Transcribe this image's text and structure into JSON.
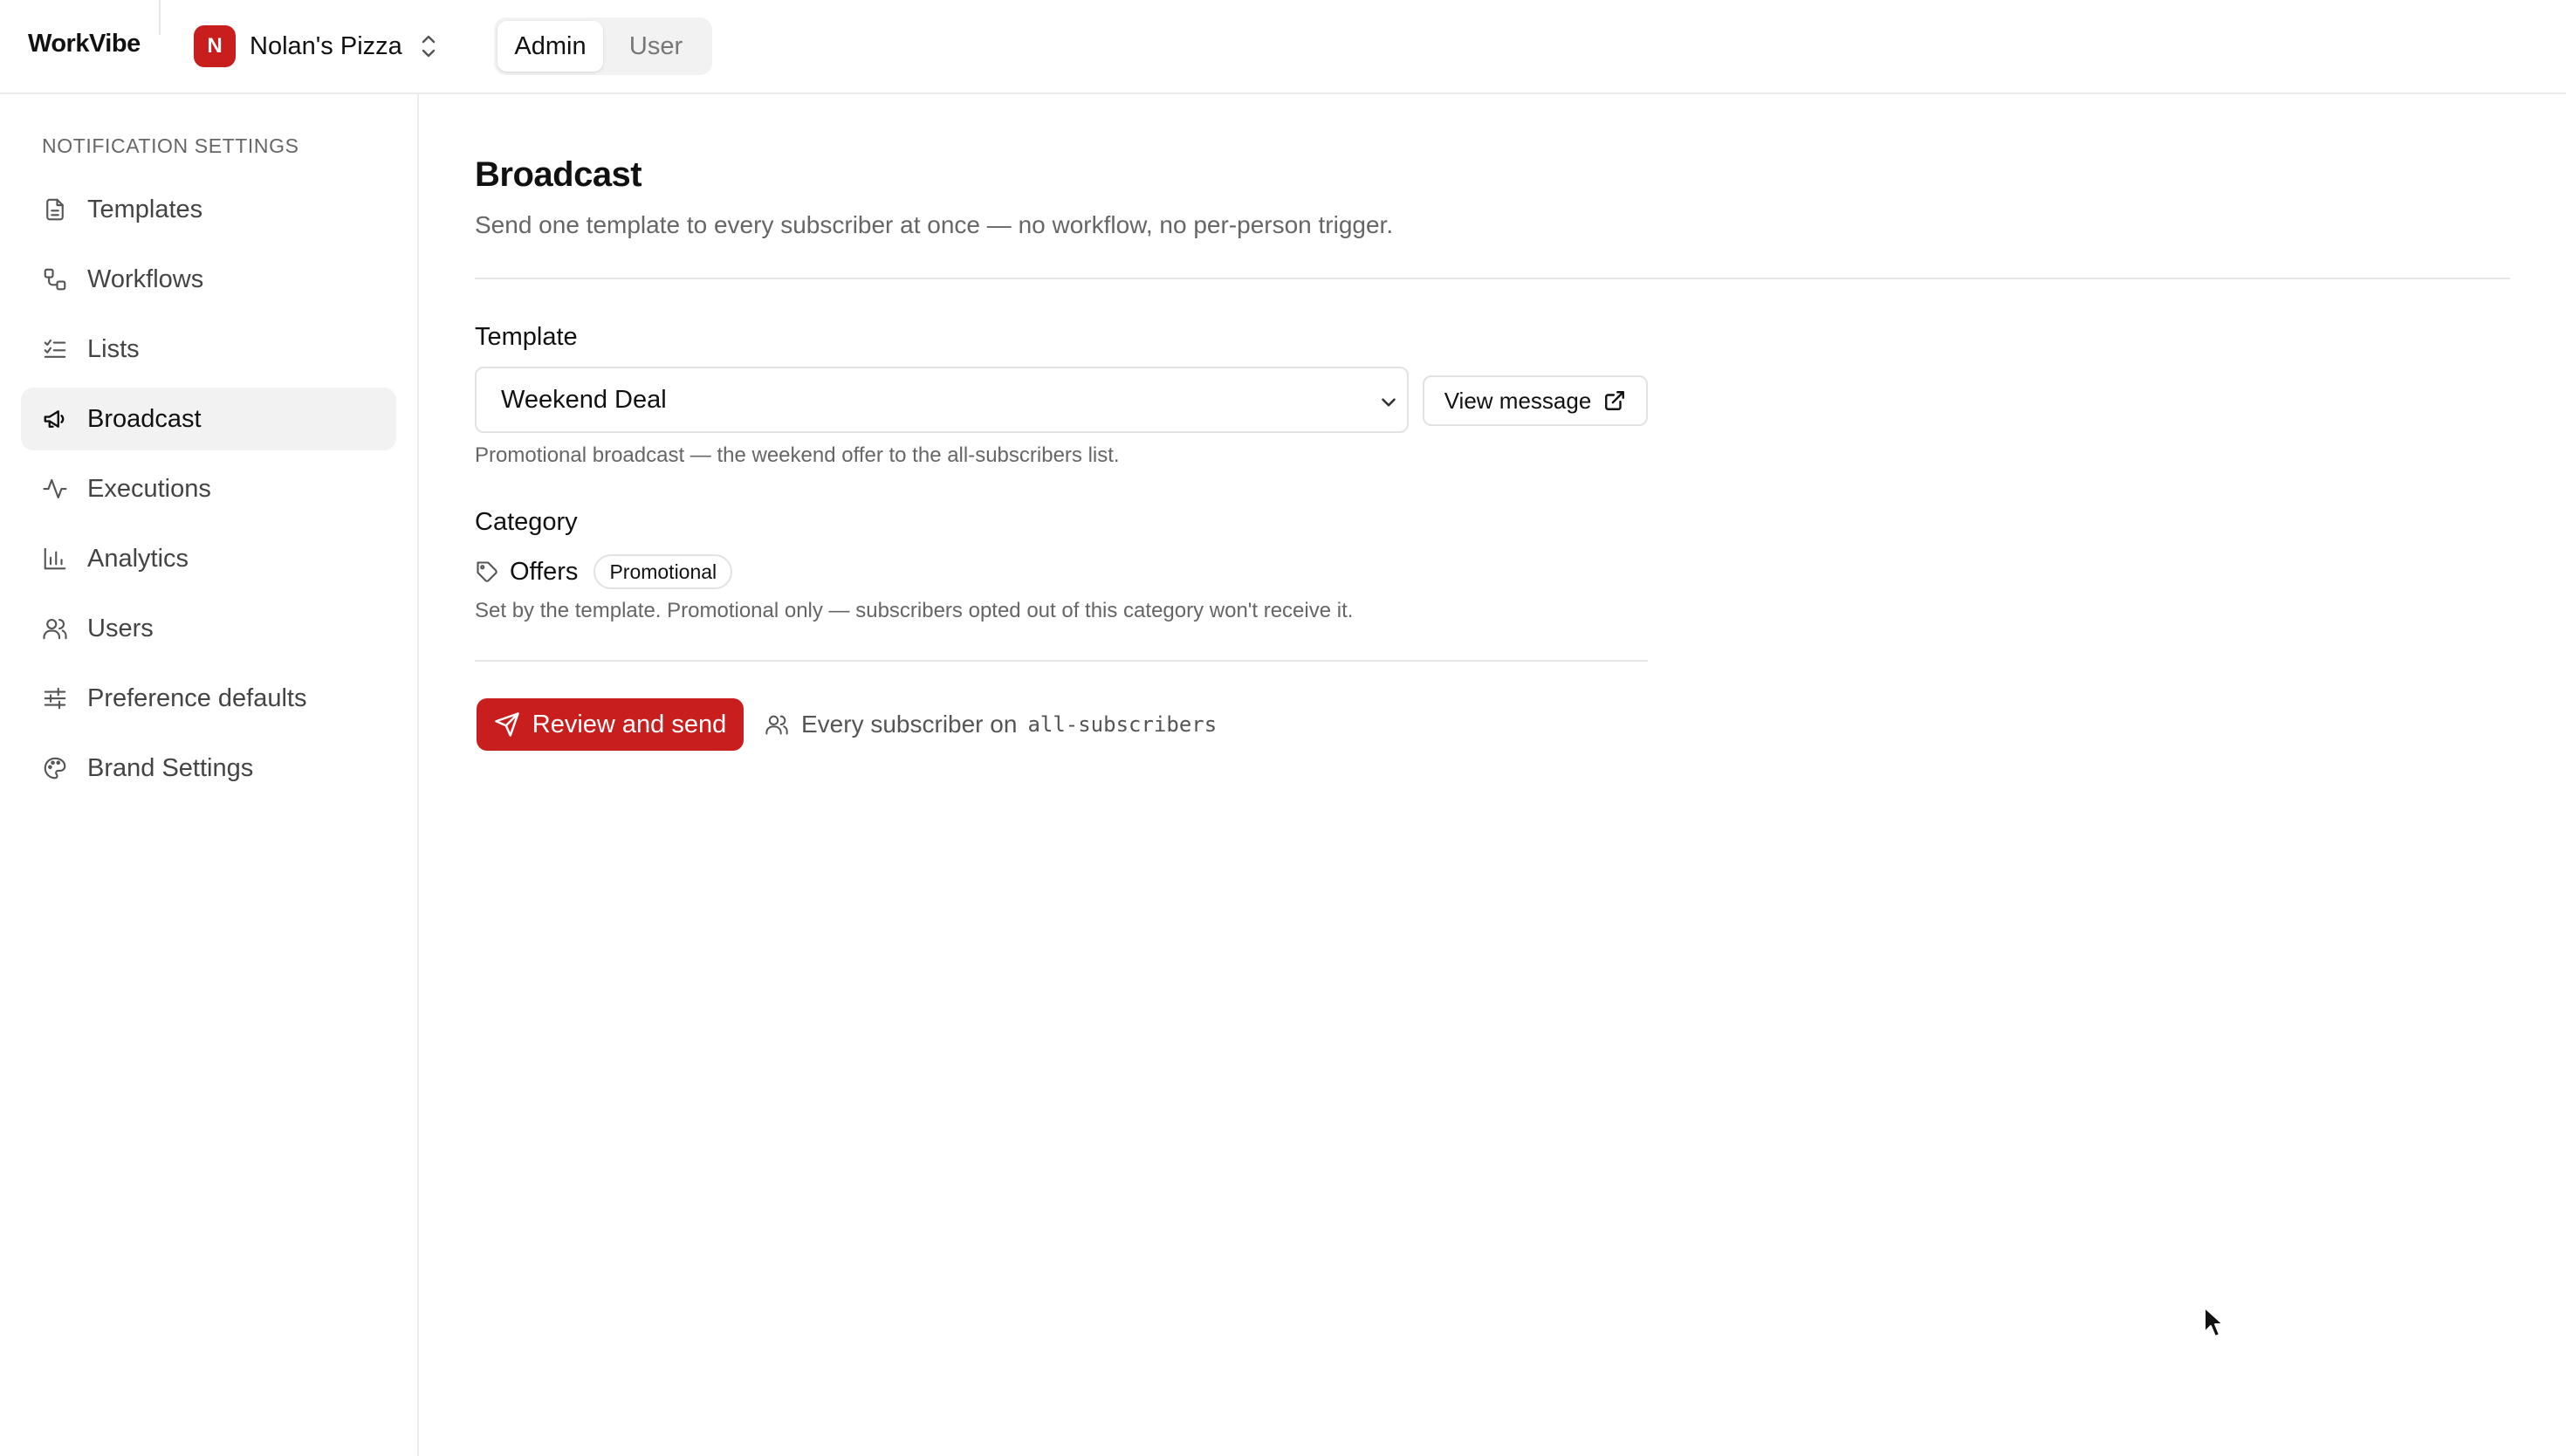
{
  "app": {
    "name": "WorkVibe",
    "org": {
      "initial": "N",
      "name": "Nolan's Pizza"
    },
    "role_toggle": {
      "options": [
        "Admin",
        "User"
      ],
      "selected": "Admin"
    }
  },
  "sidebar": {
    "heading": "NOTIFICATION SETTINGS",
    "items": [
      {
        "label": "Templates",
        "icon": "document-icon"
      },
      {
        "label": "Workflows",
        "icon": "workflow-icon"
      },
      {
        "label": "Lists",
        "icon": "list-check-icon"
      },
      {
        "label": "Broadcast",
        "icon": "megaphone-icon",
        "active": true
      },
      {
        "label": "Executions",
        "icon": "activity-icon"
      },
      {
        "label": "Analytics",
        "icon": "bar-chart-icon"
      },
      {
        "label": "Users",
        "icon": "users-icon"
      },
      {
        "label": "Preference defaults",
        "icon": "sliders-icon"
      },
      {
        "label": "Brand Settings",
        "icon": "palette-icon"
      }
    ]
  },
  "page": {
    "title": "Broadcast",
    "subtitle": "Send one template to every subscriber at once — no workflow, no per-person trigger.",
    "template": {
      "label": "Template",
      "selected": "Weekend Deal",
      "view_button": "View message",
      "help": "Promotional broadcast — the weekend offer to the all-subscribers list."
    },
    "category": {
      "label": "Category",
      "name": "Offers",
      "badge": "Promotional",
      "help": "Set by the template. Promotional only — subscribers opted out of this category won't receive it."
    },
    "send": {
      "button": "Review and send",
      "audience_prefix": "Every subscriber on",
      "audience_list": "all-subscribers"
    }
  },
  "colors": {
    "accent": "#c81e1e",
    "border": "#e2e2e2",
    "muted_text": "#666666",
    "active_bg": "#f2f2f2"
  }
}
